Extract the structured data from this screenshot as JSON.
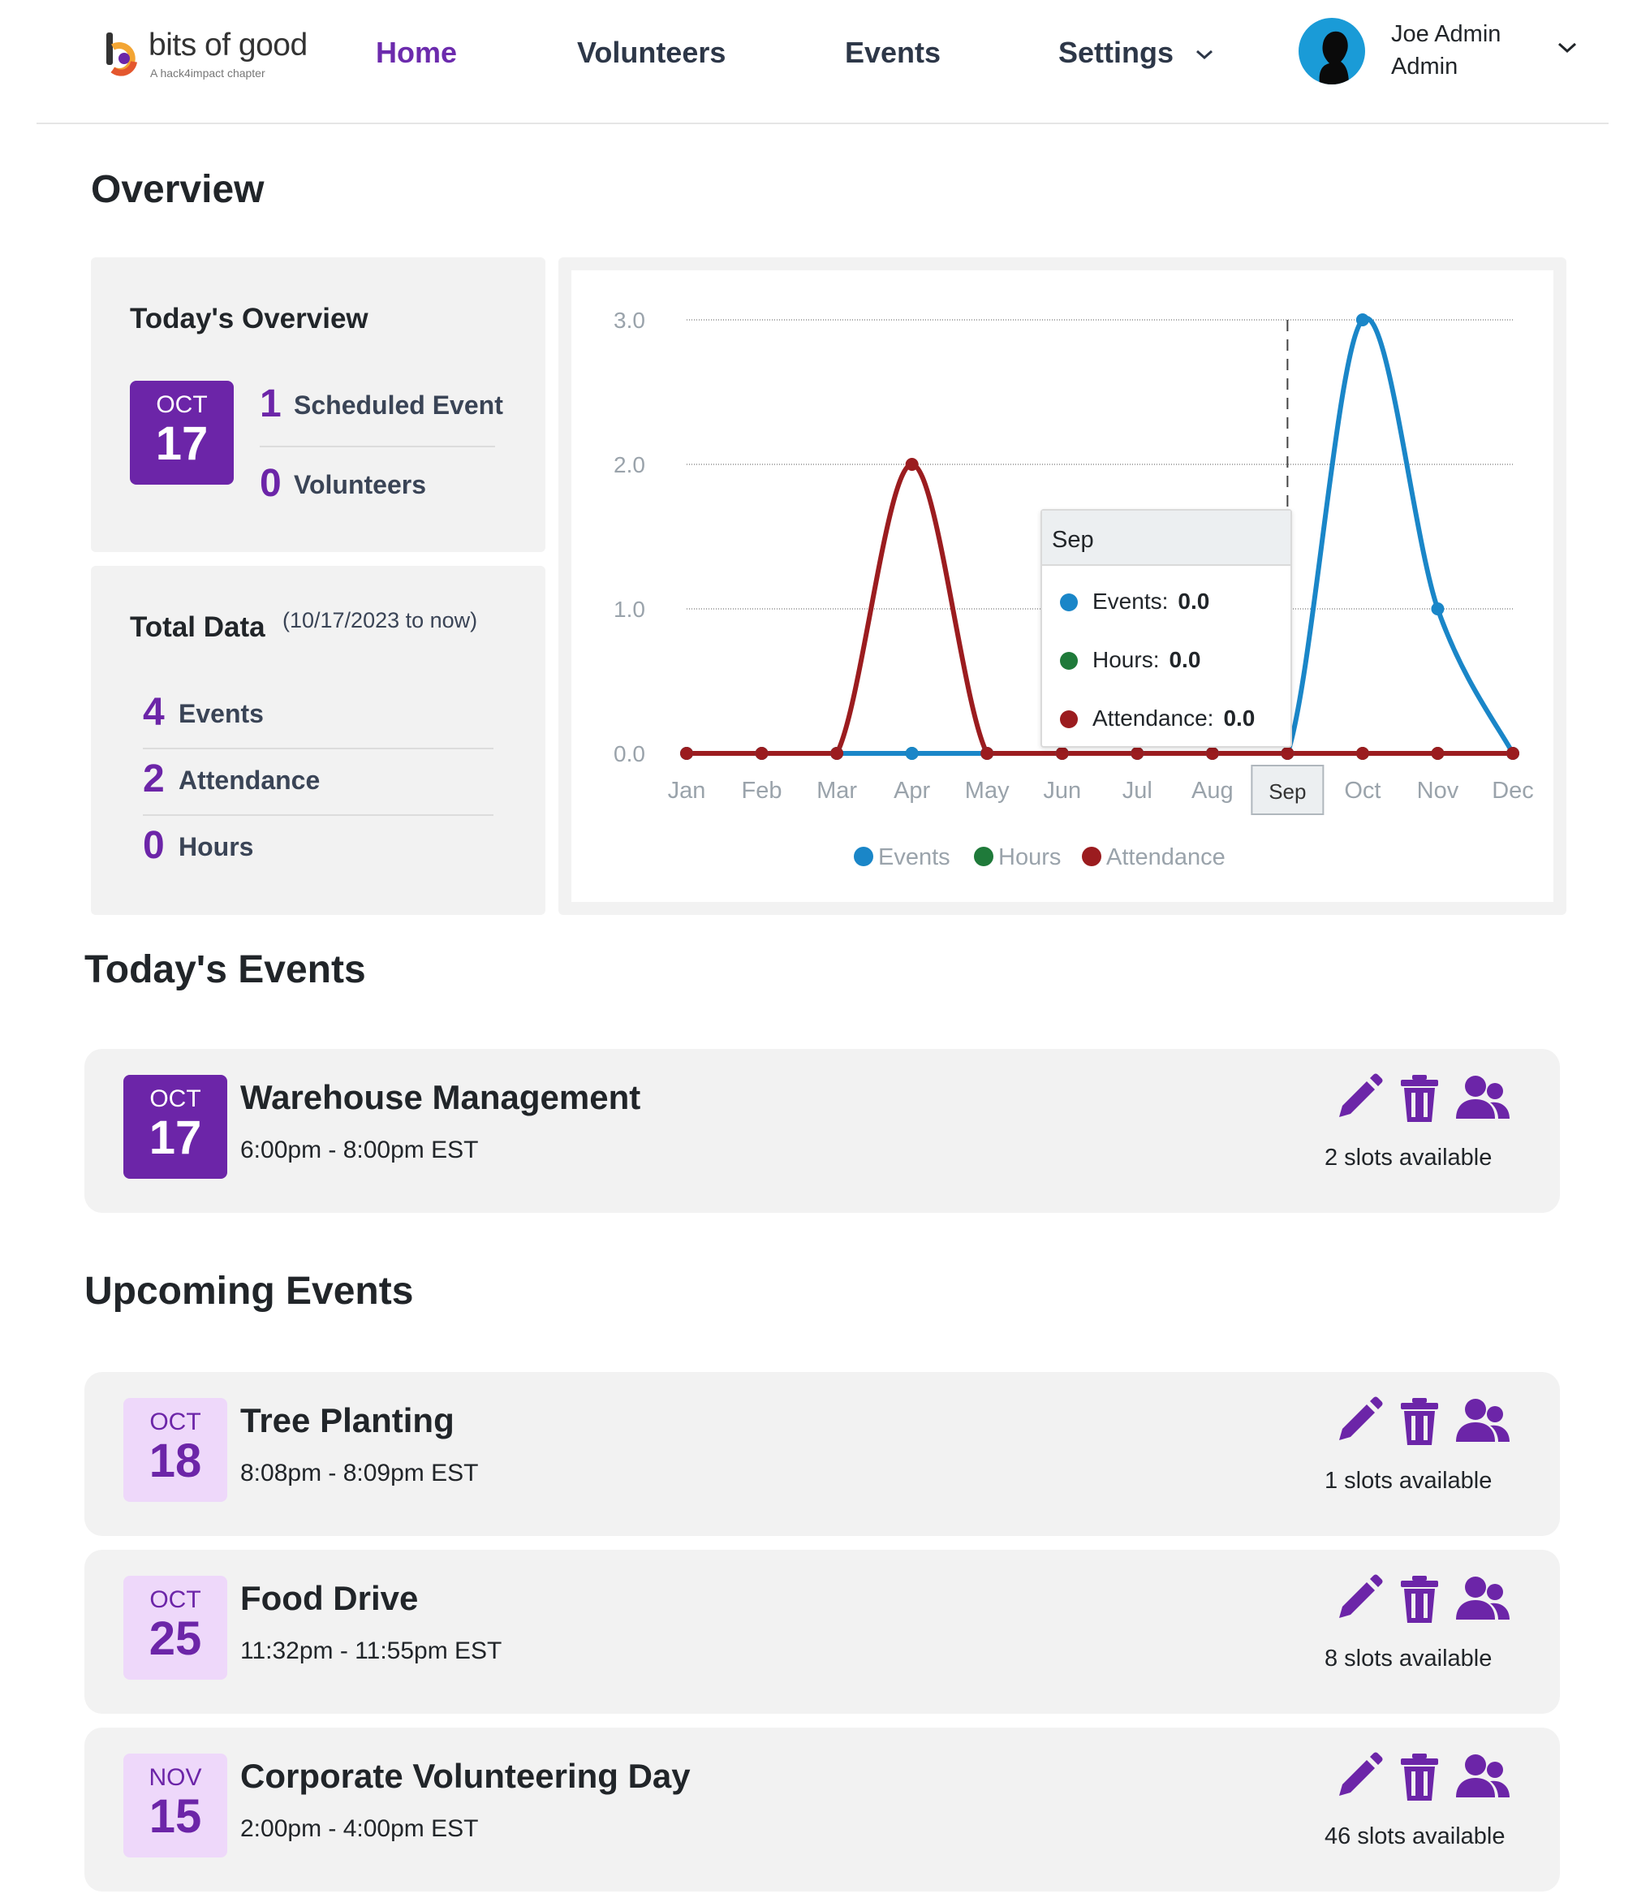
{
  "nav": {
    "logo_text": "bits of good",
    "logo_sub": "A  hack4impact chapter",
    "links": [
      "Home",
      "Volunteers",
      "Events",
      "Settings"
    ],
    "active": "Home",
    "user_name": "Joe Admin",
    "user_role": "Admin"
  },
  "overview": {
    "title": "Overview",
    "today": {
      "title": "Today's Overview",
      "month": "OCT",
      "day": "17",
      "scheduled_count": "1",
      "scheduled_label": "Scheduled Event",
      "volunteers_count": "0",
      "volunteers_label": "Volunteers"
    },
    "total": {
      "title": "Total Data",
      "range": "(10/17/2023 to now)",
      "events_count": "4",
      "events_label": "Events",
      "attendance_count": "2",
      "attendance_label": "Attendance",
      "hours_count": "0",
      "hours_label": "Hours"
    }
  },
  "chart_data": {
    "type": "line",
    "categories": [
      "Jan",
      "Feb",
      "Mar",
      "Apr",
      "May",
      "Jun",
      "Jul",
      "Aug",
      "Sep",
      "Oct",
      "Nov",
      "Dec"
    ],
    "series": [
      {
        "name": "Events",
        "color": "#1a86c8",
        "values": [
          0,
          0,
          0,
          0,
          0,
          0,
          0,
          0,
          0,
          3,
          1,
          0
        ]
      },
      {
        "name": "Hours",
        "color": "#1f7a3a",
        "values": [
          0,
          0,
          0,
          0,
          0,
          0,
          0,
          0,
          0,
          0,
          0,
          0
        ]
      },
      {
        "name": "Attendance",
        "color": "#9b1c1f",
        "values": [
          0,
          0,
          0,
          2,
          0,
          0,
          0,
          0,
          0,
          0,
          0,
          0
        ]
      }
    ],
    "yticks": [
      "0.0",
      "1.0",
      "2.0",
      "3.0"
    ],
    "ylim": [
      0,
      3
    ],
    "grid": true,
    "legend": "bottom",
    "highlight_category": "Sep",
    "tooltip": {
      "title": "Sep",
      "rows": [
        {
          "label": "Events:",
          "value": "0.0"
        },
        {
          "label": "Hours:",
          "value": "0.0"
        },
        {
          "label": "Attendance:",
          "value": "0.0"
        }
      ]
    }
  },
  "today_events": {
    "title": "Today's Events",
    "items": [
      {
        "month": "OCT",
        "day": "17",
        "title": "Warehouse Management",
        "time": "6:00pm - 8:00pm EST",
        "slots": "2 slots available"
      }
    ]
  },
  "upcoming_events": {
    "title": "Upcoming Events",
    "items": [
      {
        "month": "OCT",
        "day": "18",
        "title": "Tree Planting",
        "time": "8:08pm - 8:09pm EST",
        "slots": "1 slots available"
      },
      {
        "month": "OCT",
        "day": "25",
        "title": "Food Drive",
        "time": "11:32pm - 11:55pm EST",
        "slots": "8 slots available"
      },
      {
        "month": "NOV",
        "day": "15",
        "title": "Corporate Volunteering Day",
        "time": "2:00pm - 4:00pm EST",
        "slots": "46 slots available"
      }
    ]
  },
  "icons": {
    "edit": "pencil-icon",
    "delete": "trash-icon",
    "volunteers": "users-icon",
    "accent": "#6c25a8"
  }
}
